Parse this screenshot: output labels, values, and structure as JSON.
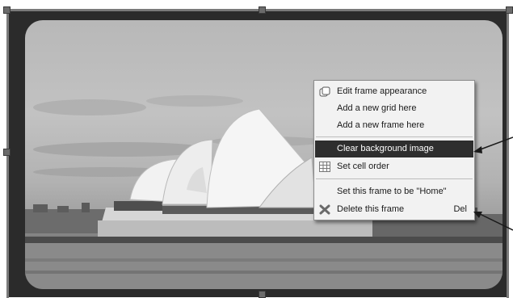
{
  "context_menu": {
    "items": [
      {
        "label": "Edit frame appearance",
        "icon": "frame-appearance-icon"
      },
      {
        "label": "Add a new grid here"
      },
      {
        "label": "Add a new frame here"
      },
      {
        "label": "Clear background image",
        "highlighted": true
      },
      {
        "label": "Set cell order",
        "icon": "grid-icon"
      },
      {
        "label": "Set this frame to be \"Home\""
      },
      {
        "label": "Delete this frame",
        "icon": "delete-x-icon",
        "shortcut": "Del"
      }
    ]
  },
  "colors": {
    "highlight": "#2e2e2e",
    "menu_bg": "#f2f2f2",
    "frame": "#2b2b2b"
  }
}
